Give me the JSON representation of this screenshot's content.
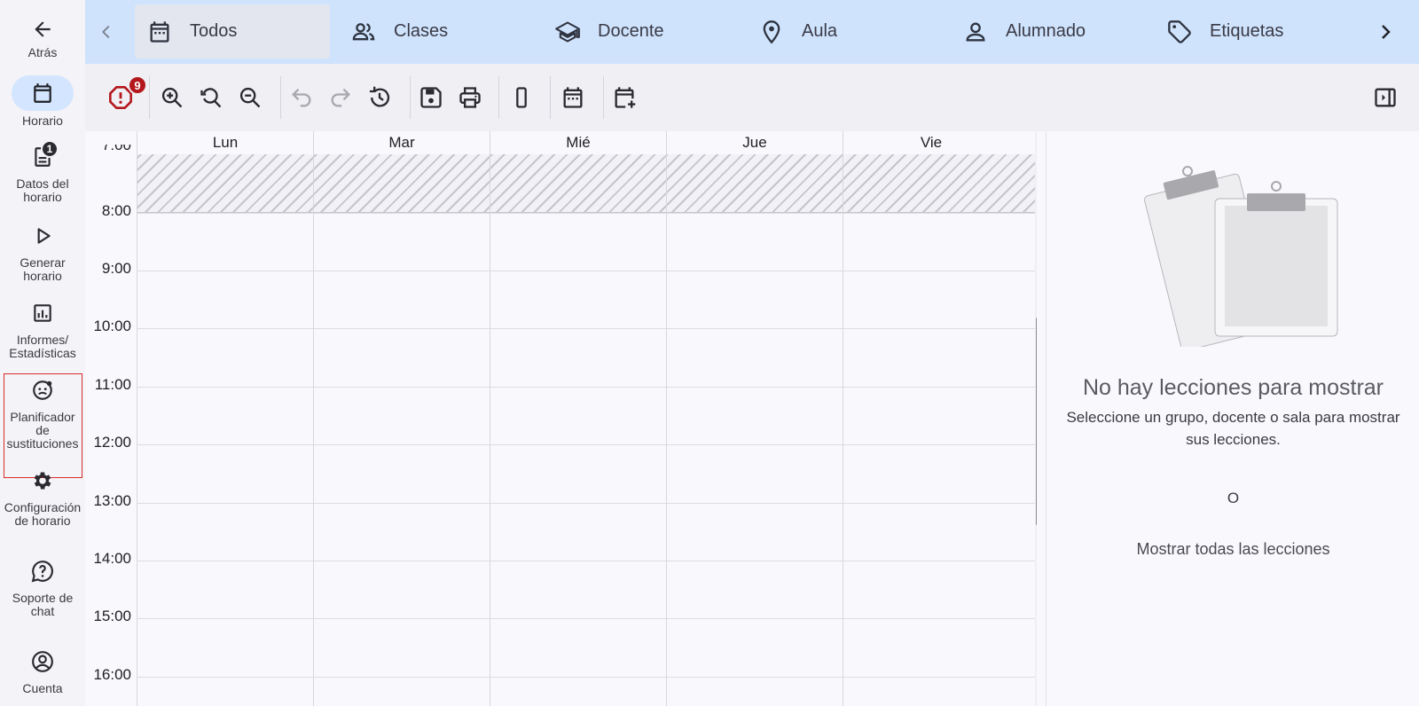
{
  "nav": {
    "back": "Atrás",
    "schedule": "Horario",
    "schedule_data": "Datos del horario",
    "schedule_data_badge": "1",
    "generate": "Generar horario",
    "reports": "Informes/ Estadísticas",
    "substitutions": "Planificador de sustituciones",
    "config": "Configuración de horario",
    "support": "Soporte de chat",
    "account": "Cuenta"
  },
  "tabs": [
    {
      "label": "Todos",
      "icon": "calendar-icon"
    },
    {
      "label": "Clases",
      "icon": "group-icon"
    },
    {
      "label": "Docente",
      "icon": "school-icon"
    },
    {
      "label": "Aula",
      "icon": "location-icon"
    },
    {
      "label": "Alumnado",
      "icon": "person-icon"
    },
    {
      "label": "Etiquetas",
      "icon": "tag-icon"
    }
  ],
  "toolbar": {
    "conflicts_badge": "9",
    "buttons": [
      "alert-icon",
      "zoom-in-icon",
      "zoom-reset-icon",
      "zoom-out-icon",
      "undo-icon",
      "redo-icon",
      "history-icon",
      "save-icon",
      "print-icon",
      "single-view-icon",
      "calendar-icon",
      "add-calendar-icon",
      "toggle-panel-icon"
    ]
  },
  "calendar": {
    "days": [
      "Lun",
      "Mar",
      "Mié",
      "Jue",
      "Vie"
    ],
    "times": [
      "7:00",
      "8:00",
      "9:00",
      "10:00",
      "11:00",
      "12:00",
      "13:00",
      "14:00",
      "15:00",
      "16:00"
    ]
  },
  "panel": {
    "title": "No hay lecciones para mostrar",
    "description": "Seleccione un grupo, docente o sala para mostrar sus lecciones.",
    "or": "O",
    "show_all": "Mostrar todas las lecciones"
  },
  "colors": {
    "tab_bar": "#cfe3fd",
    "nav_active": "#d3e5ff",
    "badge_red": "#b3161b",
    "highlight": "#d92c2c"
  }
}
